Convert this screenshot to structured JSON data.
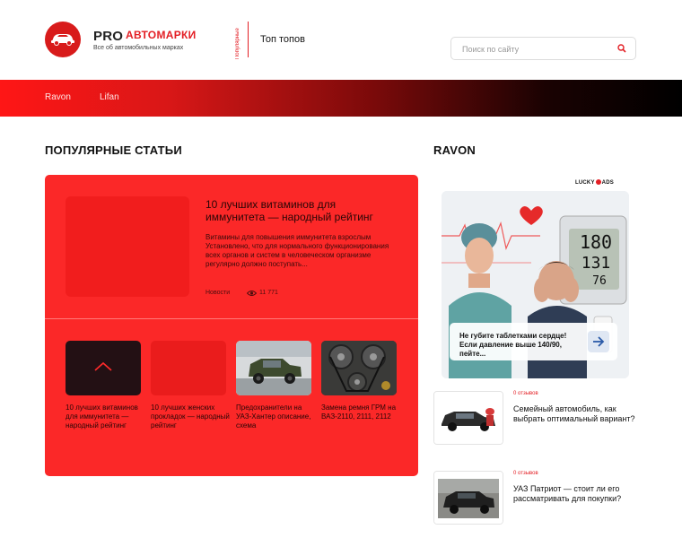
{
  "header": {
    "logo_pro": "PRO",
    "logo_brand": "АВТОМАРКИ",
    "logo_tagline": "Все об автомобильных марках",
    "vertical_label": "Популярные",
    "top_link": "Топ топов",
    "search_placeholder": "Поиск по сайту"
  },
  "nav": {
    "items": [
      "Ravon",
      "Lifan"
    ]
  },
  "popular": {
    "title": "ПОПУЛЯРНЫЕ СТАТЬИ",
    "featured": {
      "title": "10 лучших витаминов для иммунитета — народный рейтинг",
      "excerpt": "Витамины для повышения иммунитета взрослым Установлено, что для нормального функционирования всех органов и систем в человеческом организме регулярно должно поступать...",
      "category": "Новости",
      "views": "11 771"
    },
    "thumbs": [
      {
        "caption": "10 лучших витаминов для иммунитета — народный рейтинг"
      },
      {
        "caption": "10 лучших женских прокладок — народный рейтинг"
      },
      {
        "caption": "Предохранители на УАЗ-Хантер описание, схема"
      },
      {
        "caption": "Замена ремня ГРМ на ВАЗ-2110, 2111, 2112"
      }
    ]
  },
  "sidebar": {
    "title": "RAVON",
    "ad_label_left": "LUCKY",
    "ad_label_right": "ADS",
    "ad_text": "Не губите таблетками сердце! Если давление выше 140/90, пейте...",
    "monitor_values": [
      "180",
      "131",
      "76"
    ],
    "items": [
      {
        "reviews": "0 отзывов",
        "title": "Семейный автомобиль, как выбрать оптимальный вариант?"
      },
      {
        "reviews": "0 отзывов",
        "title": "УАЗ Патриот — стоит ли его рассматривать для покупки?"
      }
    ]
  },
  "colors": {
    "accent": "#e31e24",
    "card_red": "#fb2828"
  }
}
